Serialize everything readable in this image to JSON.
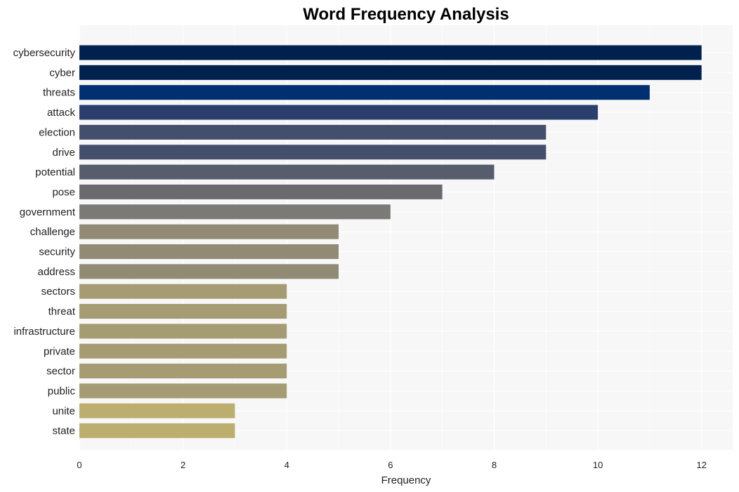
{
  "chart_data": {
    "type": "bar",
    "orientation": "horizontal",
    "title": "Word Frequency Analysis",
    "xlabel": "Frequency",
    "ylabel": "",
    "xlim": [
      0,
      12.6
    ],
    "xticks": [
      0,
      2,
      4,
      6,
      8,
      10,
      12
    ],
    "grid": true,
    "legend": "none",
    "categories": [
      "cybersecurity",
      "cyber",
      "threats",
      "attack",
      "election",
      "drive",
      "potential",
      "pose",
      "government",
      "challenge",
      "security",
      "address",
      "sectors",
      "threat",
      "infrastructure",
      "private",
      "sector",
      "public",
      "unite",
      "state"
    ],
    "values": [
      12,
      12,
      11,
      10,
      9,
      9,
      8,
      7,
      6,
      5,
      5,
      5,
      4,
      4,
      4,
      4,
      4,
      4,
      3,
      3
    ],
    "colors": [
      "#00204e",
      "#00204e",
      "#00306f",
      "#2a3f6c",
      "#444f6b",
      "#444f6b",
      "#575d6d",
      "#6b6b6f",
      "#7b7a77",
      "#918b76",
      "#918b76",
      "#918b76",
      "#a59c74",
      "#a59c74",
      "#a59c74",
      "#a59c74",
      "#a59c74",
      "#a59c74",
      "#bcae6e",
      "#bcae6e"
    ],
    "plot_background": "#f7f7f7"
  }
}
